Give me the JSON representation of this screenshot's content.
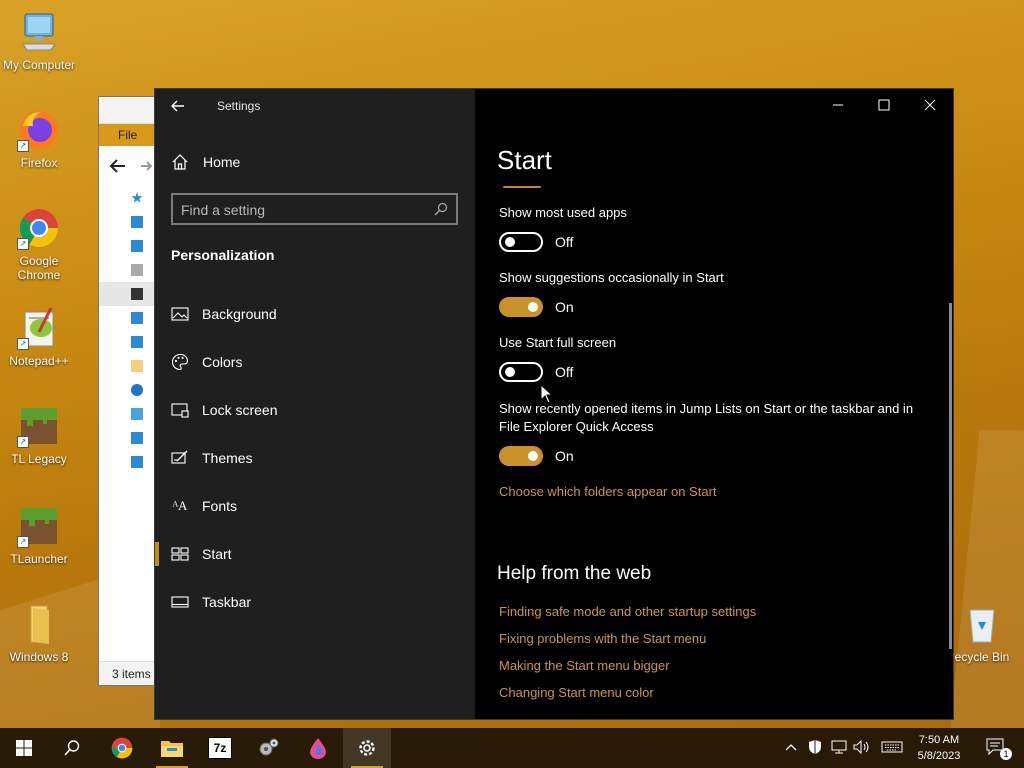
{
  "desktop": {
    "icons": [
      {
        "label": "My Computer",
        "icon": "computer-icon"
      },
      {
        "label": "Firefox",
        "icon": "firefox-icon"
      },
      {
        "label": "Google Chrome",
        "icon": "chrome-icon"
      },
      {
        "label": "Notepad++",
        "icon": "notepad-plus-plus-icon"
      },
      {
        "label": "TL Legacy",
        "icon": "minecraft-block-icon"
      },
      {
        "label": "TLauncher",
        "icon": "minecraft-block-icon"
      },
      {
        "label": "Windows 8",
        "icon": "folder-icon"
      },
      {
        "label": "ecycle Bin",
        "icon": "recycle-bin-icon"
      }
    ]
  },
  "explorer": {
    "file_tab": "File",
    "status": "3 items"
  },
  "settings": {
    "window_title": "Settings",
    "home_label": "Home",
    "search_placeholder": "Find a setting",
    "section": "Personalization",
    "nav": [
      {
        "label": "Background",
        "icon": "picture-icon"
      },
      {
        "label": "Colors",
        "icon": "palette-icon"
      },
      {
        "label": "Lock screen",
        "icon": "lock-screen-icon"
      },
      {
        "label": "Themes",
        "icon": "themes-icon"
      },
      {
        "label": "Fonts",
        "icon": "fonts-icon"
      },
      {
        "label": "Start",
        "icon": "start-layout-icon",
        "active": true
      },
      {
        "label": "Taskbar",
        "icon": "taskbar-icon"
      }
    ],
    "page_title": "Start",
    "options": [
      {
        "label": "Show most used apps",
        "state": "Off"
      },
      {
        "label": "Show suggestions occasionally in Start",
        "state": "On"
      },
      {
        "label": "Use Start full screen",
        "state": "Off"
      },
      {
        "label": "Show recently opened items in Jump Lists on Start or the taskbar and in File Explorer Quick Access",
        "state": "On"
      }
    ],
    "folders_link": "Choose which folders appear on Start",
    "help_title": "Help from the web",
    "help_links": [
      "Finding safe mode and other startup settings",
      "Fixing problems with the Start menu",
      "Making the Start menu bigger",
      "Changing Start menu color"
    ],
    "accent_color": "#c68a1c"
  },
  "taskbar": {
    "clock_time": "7:50 AM",
    "clock_date": "5/8/2023",
    "notification_count": "1"
  }
}
